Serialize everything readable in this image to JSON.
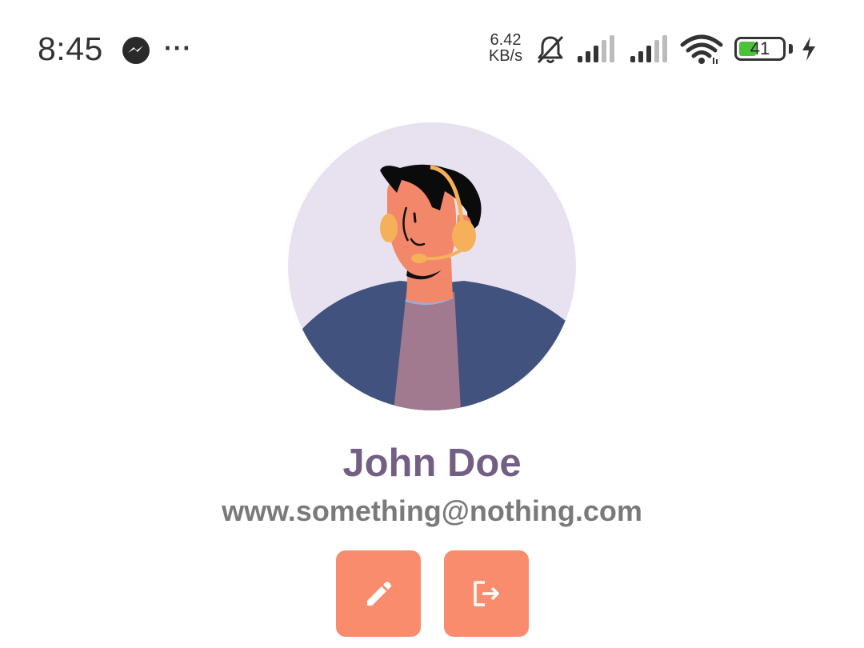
{
  "status_bar": {
    "time": "8:45",
    "more": "···",
    "net_speed_value": "6.42",
    "net_speed_unit": "KB/s",
    "battery_level": "41",
    "battery_fraction": 0.41,
    "icons": [
      "messenger-icon",
      "bell-off-icon",
      "signal-icon",
      "signal-icon",
      "wifi-icon",
      "battery-icon",
      "charging-icon"
    ]
  },
  "profile": {
    "name": "John Doe",
    "email": "www.something@nothing.com",
    "avatar_icon": "avatar-illustration"
  },
  "actions": {
    "edit_icon": "pencil-icon",
    "logout_icon": "logout-icon"
  },
  "colors": {
    "accent": "#f88c6d",
    "name": "#735f83",
    "email": "#7a7a7a",
    "avatar_bg": "#e8e2f0",
    "battery": "#4cc23a"
  }
}
